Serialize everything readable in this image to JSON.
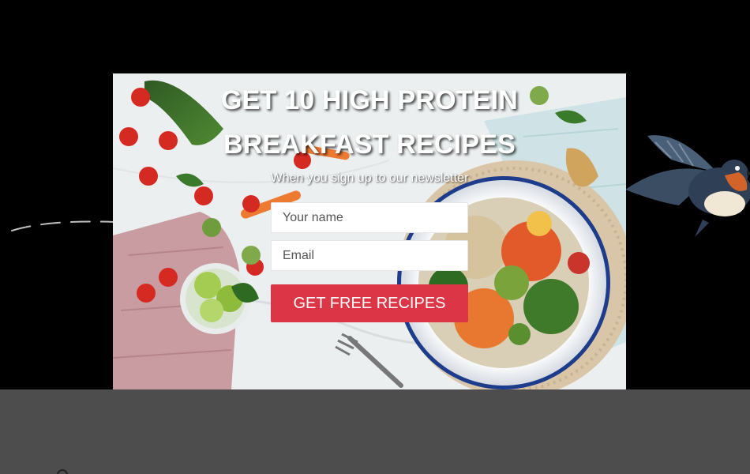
{
  "popup": {
    "headline_line1": "GET 10 HIGH PROTEIN",
    "headline_line2": "BREAKFAST RECIPES",
    "subtext": "When you sign up to our newsletter",
    "name_placeholder": "Your name",
    "email_placeholder": "Email",
    "submit_label": "GET FREE RECIPES",
    "accent_color": "#dc3545"
  },
  "background_image": "healthy salad bowl with vegetables, cherry tomatoes, limes and fork",
  "page": {
    "decor": [
      "dashed-flight-path",
      "swallow-bird-illustration"
    ]
  }
}
